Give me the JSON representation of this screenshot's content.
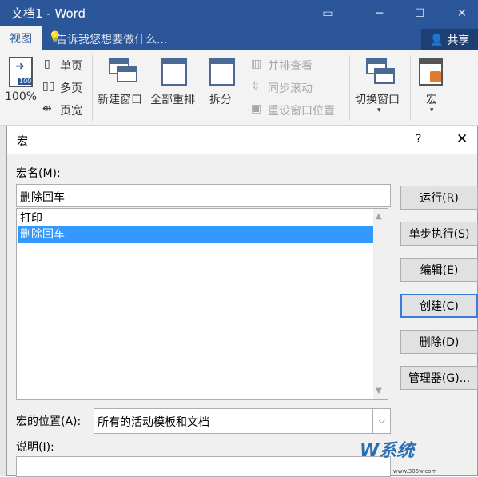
{
  "window": {
    "title": "文档1 - Word"
  },
  "ribbon_tabs": {
    "view_tab": "视图",
    "tell_me": "告诉我您想要做什么...",
    "share": "共享"
  },
  "ribbon": {
    "zoom_100": "100%",
    "zoom_icon_badge": "100",
    "one_page": "单页",
    "multi_page": "多页",
    "page_width": "页宽",
    "new_window": "新建窗口",
    "arrange_all": "全部重排",
    "split": "拆分",
    "view_side_by_side": "并排查看",
    "sync_scrolling": "同步滚动",
    "reset_window_position": "重设窗口位置",
    "switch_windows": "切换窗口",
    "macros": "宏"
  },
  "dialog": {
    "title": "宏",
    "help": "?",
    "macro_name_label": "宏名(M):",
    "macro_name_value": "删除回车",
    "macro_list": [
      "打印",
      "删除回车"
    ],
    "selected_index": 1,
    "buttons": {
      "run": "运行(R)",
      "step_into": "单步执行(S)",
      "edit": "编辑(E)",
      "create": "创建(C)",
      "delete": "删除(D)",
      "organizer": "管理器(G)..."
    },
    "macros_in_label": "宏的位置(A):",
    "macros_in_value": "所有的活动模板和文档",
    "description_label": "说明(I):"
  },
  "watermark": {
    "text": "W系统",
    "sub": "www.306w.com"
  }
}
